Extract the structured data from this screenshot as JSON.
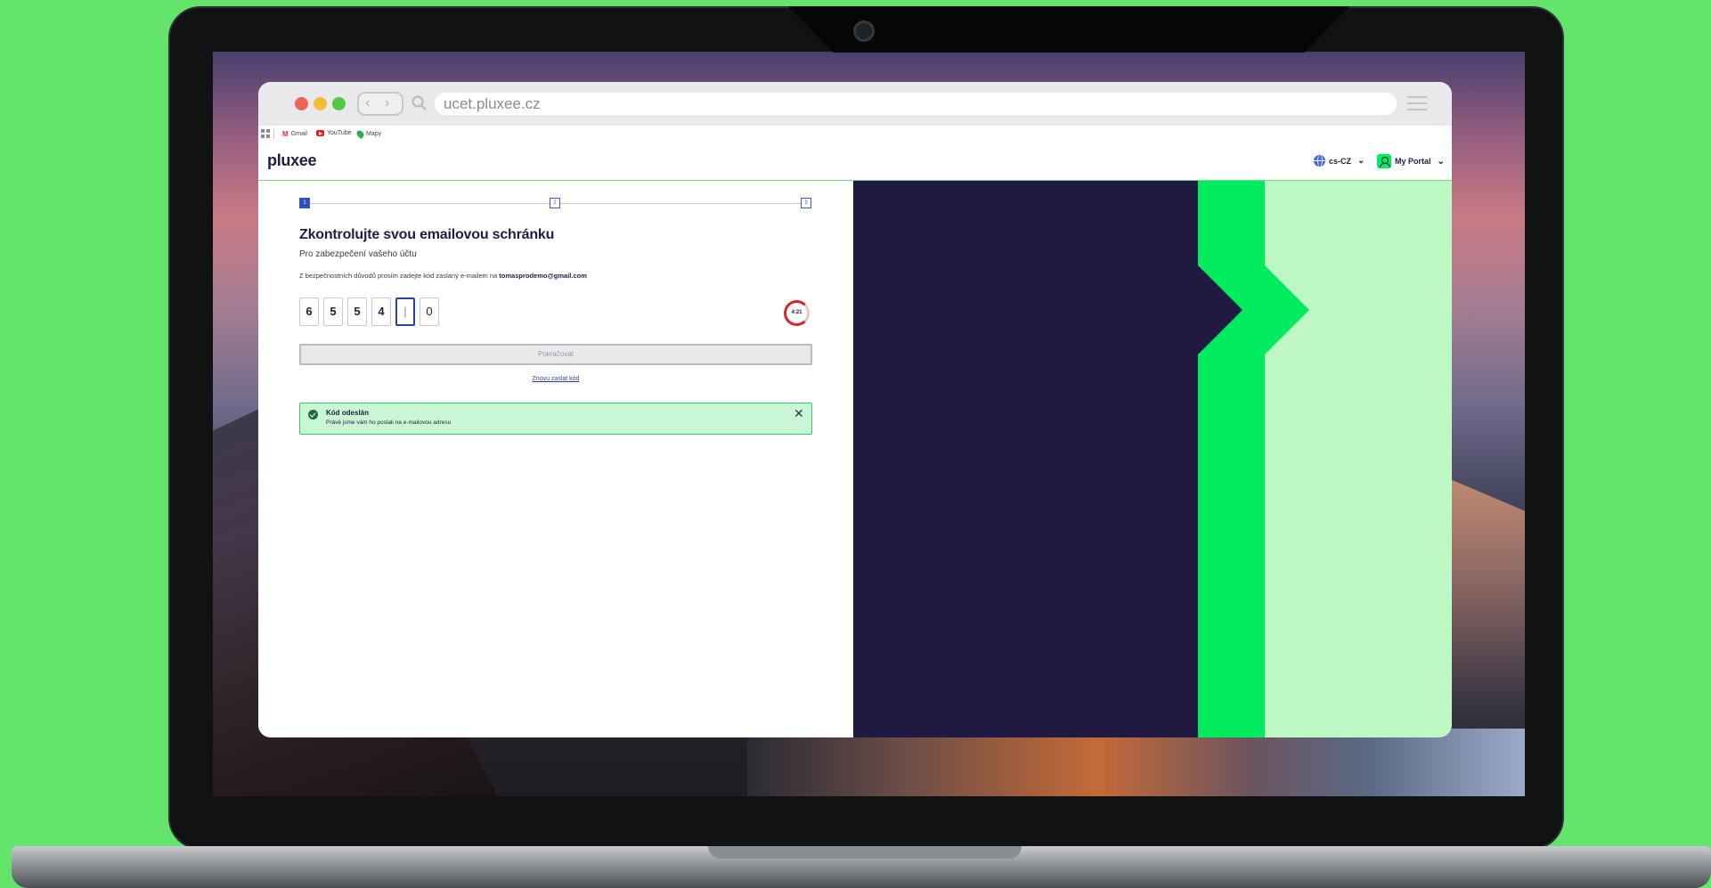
{
  "browser": {
    "url": "ucet.pluxee.cz",
    "bookmarks": [
      {
        "label": "Gmail",
        "icon": "gmail-icon"
      },
      {
        "label": "YouTube",
        "icon": "youtube-icon"
      },
      {
        "label": "Mapy",
        "icon": "maps-icon"
      }
    ]
  },
  "header": {
    "logo": "pluxee",
    "language": "cs-CZ",
    "portal": "My Portal"
  },
  "stepper": {
    "steps": [
      "1",
      "2",
      "3"
    ],
    "current": 1
  },
  "main": {
    "title": "Zkontrolujte svou emailovou schránku",
    "subtitle": "Pro zabezpečení vašeho účtu",
    "info_prefix": "Z bezpečnostních důvodů prosím zadejte kód zaslaný e-mailem na",
    "email": "tomasprodemo@gmail.com",
    "otp": [
      "6",
      "5",
      "5",
      "4",
      "|",
      "0"
    ],
    "timer": "4:21",
    "continue_label": "Pokračovat",
    "resend_label": "Znovu zaslat kód"
  },
  "toast": {
    "title": "Kód odeslán",
    "text": "Právě jsme vám ho poslali na e-mailovou adresu"
  },
  "colors": {
    "brand_dark": "#221c46",
    "brand_green": "#00eb5e",
    "brand_light_green": "#bdf7c4",
    "accent_blue": "#2f4cc1",
    "timer_red": "#d8242b",
    "backdrop": "#63e56b"
  }
}
